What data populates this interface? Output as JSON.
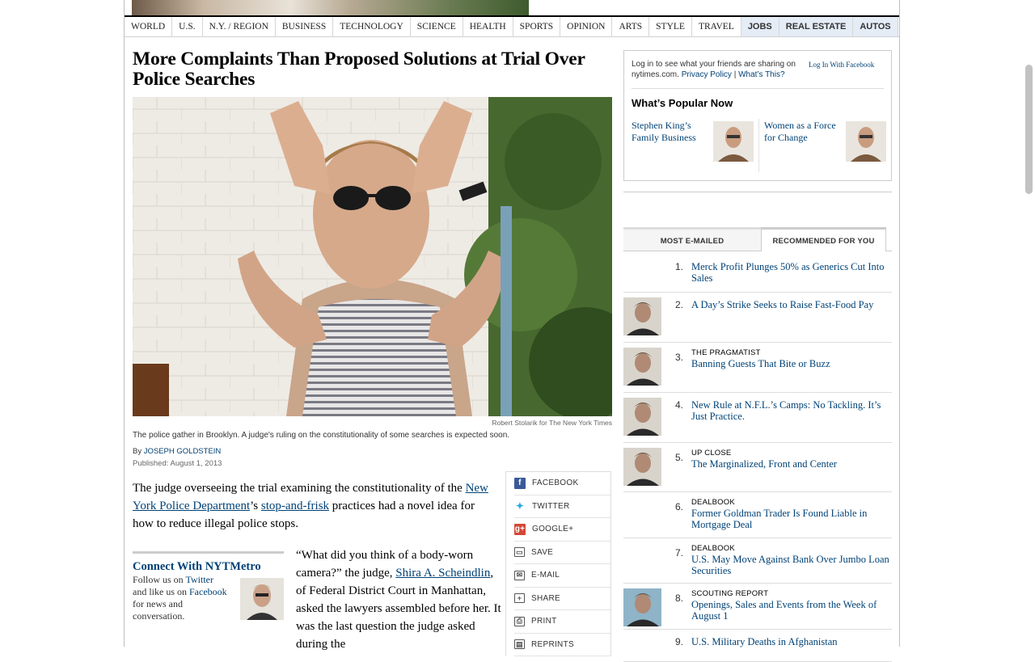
{
  "nav": {
    "items": [
      "WORLD",
      "U.S.",
      "N.Y. / REGION",
      "BUSINESS",
      "TECHNOLOGY",
      "SCIENCE",
      "HEALTH",
      "SPORTS",
      "OPINION",
      "ARTS",
      "STYLE",
      "TRAVEL"
    ],
    "highlight_items": [
      "JOBS",
      "REAL ESTATE",
      "AUTOS"
    ]
  },
  "article": {
    "headline": "More Complaints Than Proposed Solutions at Trial Over Police Searches",
    "photo_credit": "Robert Stolarik for The New York Times",
    "caption": "The police gather in Brooklyn. A judge's ruling on the constitutionality of some searches is expected soon.",
    "byline_prefix": "By ",
    "author": "JOSEPH GOLDSTEIN",
    "published": "Published: August 1, 2013",
    "p1": {
      "a": "The judge overseeing the trial examining the constitutionality of the ",
      "link1": "New York Police Department",
      "b": "’s ",
      "link2": "stop-and-frisk",
      "c": " practices had a novel idea for how to reduce illegal police stops."
    },
    "p2": {
      "a": "“What did you think of a body-worn camera?” the judge, ",
      "link1": "Shira A. Scheindlin",
      "b": ", of Federal District Court in Manhattan, asked the lawyers assembled before her. It was the last question the judge asked during the"
    }
  },
  "connect": {
    "title": "Connect With NYTMetro",
    "l1a": "Follow us on ",
    "l1b": "Twitter",
    "l2a": "and like us on ",
    "l2b": "Facebook",
    "l3": "for news and",
    "l4": "conversation."
  },
  "share": {
    "items": [
      {
        "label": "FACEBOOK",
        "icon": "facebook-icon",
        "color": "#3b5998"
      },
      {
        "label": "TWITTER",
        "icon": "twitter-icon",
        "color": "#2aa9e0"
      },
      {
        "label": "GOOGLE+",
        "icon": "google-plus-icon",
        "color": "#d34836"
      },
      {
        "label": "SAVE",
        "icon": "folder-icon",
        "color": "#555555"
      },
      {
        "label": "E-MAIL",
        "icon": "envelope-icon",
        "color": "#555555"
      },
      {
        "label": "SHARE",
        "icon": "plus-box-icon",
        "color": "#555555"
      },
      {
        "label": "PRINT",
        "icon": "printer-icon",
        "color": "#555555"
      },
      {
        "label": "REPRINTS",
        "icon": "reprints-icon",
        "color": "#555555"
      }
    ]
  },
  "login": {
    "text_a": "Log in to see what your friends are sharing on",
    "text_b": "nytimes.com.",
    "privacy": "Privacy Policy",
    "sep": " | ",
    "whats_this": "What’s This?",
    "fb_button": "Log In With Facebook"
  },
  "popular": {
    "title": "What’s Popular Now",
    "items": [
      "Stephen King’s Family Business",
      "Women as a Force for Change"
    ]
  },
  "tabs": {
    "most_emailed": "MOST E-MAILED",
    "recommended": "RECOMMENDED FOR YOU"
  },
  "recommended": [
    {
      "num": "1.",
      "kicker": "",
      "title": "Merck Profit Plunges 50% as Generics Cut Into Sales"
    },
    {
      "num": "2.",
      "kicker": "",
      "title": "A Day’s Strike Seeks to Raise Fast-Food Pay"
    },
    {
      "num": "3.",
      "kicker": "THE PRAGMATIST",
      "title": "Banning Guests That Bite or Buzz"
    },
    {
      "num": "4.",
      "kicker": "",
      "title": "New Rule at N.F.L.’s Camps: No Tackling. It’s Just Practice."
    },
    {
      "num": "5.",
      "kicker": "UP CLOSE",
      "title": "The Marginalized, Front and Center"
    },
    {
      "num": "6.",
      "kicker": "DEALBOOK",
      "title": "Former Goldman Trader Is Found Liable in Mortgage Deal"
    },
    {
      "num": "7.",
      "kicker": "DEALBOOK",
      "title": "U.S. May Move Against Bank Over Jumbo Loan Securities"
    },
    {
      "num": "8.",
      "kicker": "SCOUTING REPORT",
      "title": "Openings, Sales and Events from the Week of August 1"
    },
    {
      "num": "9.",
      "kicker": "",
      "title": "U.S. Military Deaths in Afghanistan"
    }
  ]
}
